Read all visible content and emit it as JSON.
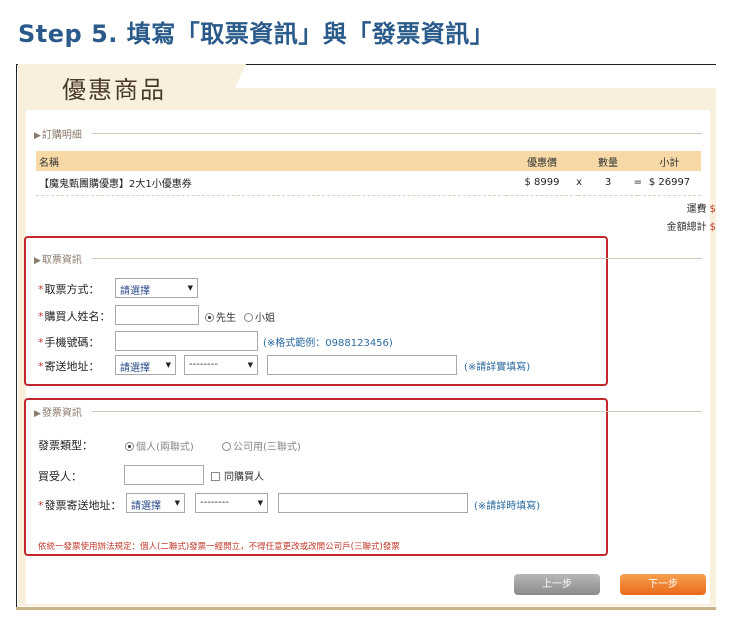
{
  "step_title": "Step 5. 填寫「取票資訊」與「發票資訊」",
  "page_heading": "優惠商品",
  "order": {
    "legend": "訂購明細",
    "columns": [
      "名稱",
      "優惠價",
      "數量",
      "小計"
    ],
    "rows": [
      {
        "name": "【魔鬼甄團購優惠】2大1小優惠券",
        "price": "$ 8999",
        "times": "x",
        "qty": "3",
        "eq": "=",
        "subtotal": "$ 26997"
      }
    ],
    "shipping_label": "運費",
    "total_label": "金額總計",
    "currency_mark": "$"
  },
  "ticket": {
    "legend": "取票資訊",
    "method_label": "取票方式：",
    "method_value": "請選擇",
    "name_label": "購買人姓名：",
    "name_value": "",
    "gender_options": [
      "先生",
      "小姐"
    ],
    "gender_selected": "先生",
    "phone_label": "手機號碼：",
    "phone_value": "",
    "phone_hint": "(※格式範例：0988123456)",
    "address_label": "寄送地址：",
    "city_value": "請選擇",
    "district_value": "--------",
    "address_value": "",
    "address_hint": "(※請詳實填寫)"
  },
  "invoice": {
    "legend": "發票資訊",
    "type_label": "發票類型：",
    "type_options": [
      "個人(兩聯式)",
      "公司用(三聯式)"
    ],
    "type_selected": "個人(兩聯式)",
    "buyer_label": "買受人：",
    "buyer_value": "",
    "same_as_buyer_label": "同購買人",
    "address_label": "發票寄送地址：",
    "city_value": "請選擇",
    "district_value": "--------",
    "address_value": "",
    "address_hint": "(※請詳時填寫)",
    "notice": "依統一發票使用辦法規定：個人(二聯式)發票一經開立，不得任意更改或改開公司戶(三聯式)發票"
  },
  "buttons": {
    "prev": "上一步",
    "next": "下一步"
  },
  "colors": {
    "title_blue": "#2a5a8a",
    "panel_cream": "#f8f0dc",
    "table_header": "#f7d9a8",
    "highlight_red": "#c0282e",
    "next_orange": "#ea6a1a",
    "prev_gray": "#8a8a8a",
    "hint_blue": "#2a6aa0"
  }
}
